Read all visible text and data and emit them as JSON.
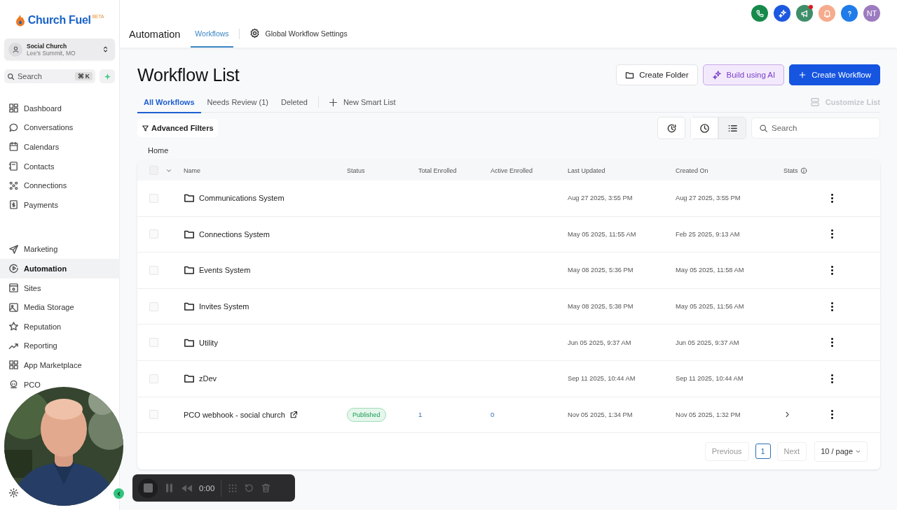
{
  "sidebar": {
    "brand": "Church Fuel",
    "brand_badge": "BETA",
    "account": {
      "name": "Social Church",
      "location": "Lee's Summit, MO"
    },
    "search": {
      "placeholder": "Search",
      "shortcut": "⌘ K"
    },
    "sections": [
      {
        "items": [
          {
            "label": "Dashboard",
            "selected": false
          },
          {
            "label": "Conversations",
            "selected": false
          },
          {
            "label": "Calendars",
            "selected": false
          },
          {
            "label": "Contacts",
            "selected": false
          },
          {
            "label": "Connections",
            "selected": false
          },
          {
            "label": "Payments",
            "selected": false
          }
        ]
      },
      {
        "items": [
          {
            "label": "Marketing",
            "selected": false
          },
          {
            "label": "Automation",
            "selected": true
          },
          {
            "label": "Sites",
            "selected": false
          },
          {
            "label": "Media Storage",
            "selected": false
          },
          {
            "label": "Reputation",
            "selected": false
          },
          {
            "label": "Reporting",
            "selected": false
          },
          {
            "label": "App Marketplace",
            "selected": false
          },
          {
            "label": "PCO",
            "selected": false
          }
        ]
      }
    ]
  },
  "topbar": {
    "title": "Automation",
    "tabs": [
      {
        "label": "Workflows",
        "selected": true
      },
      {
        "label": "Global Workflow Settings",
        "selected": false
      }
    ],
    "announcements_unread": true,
    "avatar": "NT"
  },
  "page": {
    "title": "Workflow List",
    "actions": [
      {
        "label": "Create Folder",
        "kind": "outline"
      },
      {
        "label": "Build using AI",
        "kind": "ai"
      },
      {
        "label": "Create Workflow",
        "kind": "primary"
      }
    ],
    "tabs": [
      {
        "label": "All Workflows",
        "selected": true
      },
      {
        "label": "Needs Review (1)",
        "selected": false
      },
      {
        "label": "Deleted",
        "selected": false
      }
    ],
    "new_smart_list": "New Smart List",
    "customize_list": {
      "label": "Customize List",
      "disabled": true
    },
    "advanced_filters": "Advanced Filters",
    "view_buttons": [
      {
        "selected": false
      },
      {
        "selected": true
      }
    ],
    "search": {
      "placeholder": "Search"
    },
    "breadcrumb": "Home",
    "table": {
      "all_checked": false,
      "columns": [
        "Name",
        "Status",
        "Total Enrolled",
        "Active Enrolled",
        "Last Updated",
        "Created On",
        "Stats"
      ],
      "rows": [
        {
          "kind": "folder",
          "checked": false,
          "name": "Communications System",
          "last_updated": "Aug 27 2025, 3:55 PM",
          "created_on": "Aug 27 2025, 3:55 PM"
        },
        {
          "kind": "folder",
          "checked": false,
          "name": "Connections System",
          "last_updated": "May 05 2025, 11:55 AM",
          "created_on": "Feb 25 2025, 9:13 AM"
        },
        {
          "kind": "folder",
          "checked": false,
          "name": "Events System",
          "last_updated": "May 08 2025, 5:36 PM",
          "created_on": "May 05 2025, 11:58 AM"
        },
        {
          "kind": "folder",
          "checked": false,
          "name": "Invites System",
          "last_updated": "May 08 2025, 5:38 PM",
          "created_on": "May 05 2025, 11:56 AM"
        },
        {
          "kind": "folder",
          "checked": false,
          "name": "Utility",
          "last_updated": "Jun 05 2025, 9:37 AM",
          "created_on": "Jun 05 2025, 9:37 AM"
        },
        {
          "kind": "folder",
          "checked": false,
          "name": "zDev",
          "last_updated": "Sep 11 2025, 10:44 AM",
          "created_on": "Sep 11 2025, 10:44 AM"
        },
        {
          "kind": "workflow",
          "checked": false,
          "name": "PCO webhook - social church",
          "status": "Published",
          "total_enrolled": "1",
          "active_enrolled": "0",
          "last_updated": "Nov 05 2025, 1:34 PM",
          "created_on": "Nov 05 2025, 1:32 PM"
        }
      ]
    },
    "pagination": {
      "previous": "Previous",
      "current": "1",
      "next": "Next",
      "page_size": "10 / page"
    }
  },
  "recorder": {
    "time": "0:00"
  }
}
